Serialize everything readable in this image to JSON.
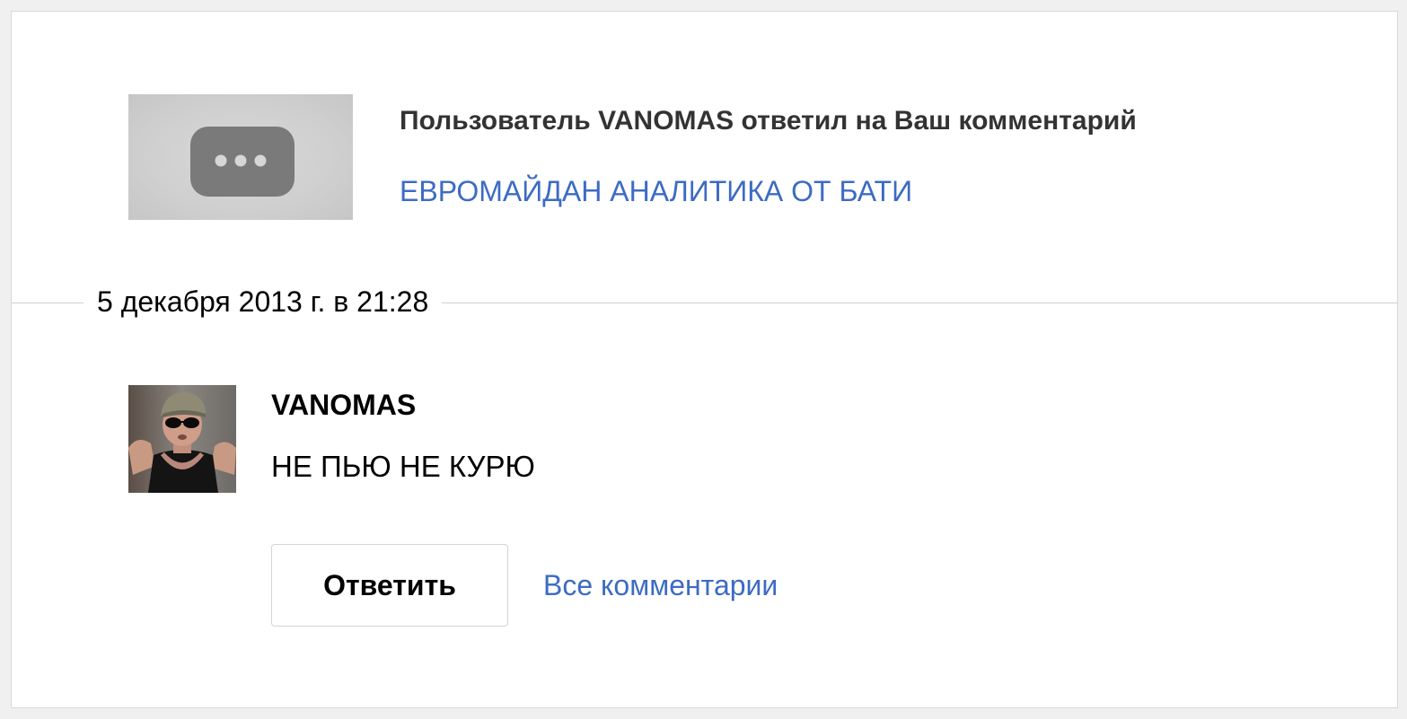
{
  "notification": {
    "title": "Пользователь VANOMAS ответил на Ваш комментарий",
    "video_title": "ЕВРОМАЙДАН АНАЛИТИКА ОТ БАТИ",
    "thumbnail_icon": "ellipsis-icon"
  },
  "comment": {
    "date": "5 декабря 2013 г. в 21:28",
    "author": "VANOMAS",
    "text": "НЕ ПЬЮ НЕ КУРЮ",
    "avatar": "user-avatar"
  },
  "actions": {
    "reply_label": "Ответить",
    "all_comments_label": "Все комментарии"
  },
  "colors": {
    "link": "#3d6bc4",
    "title": "#333333",
    "border": "#d9d9d9"
  }
}
